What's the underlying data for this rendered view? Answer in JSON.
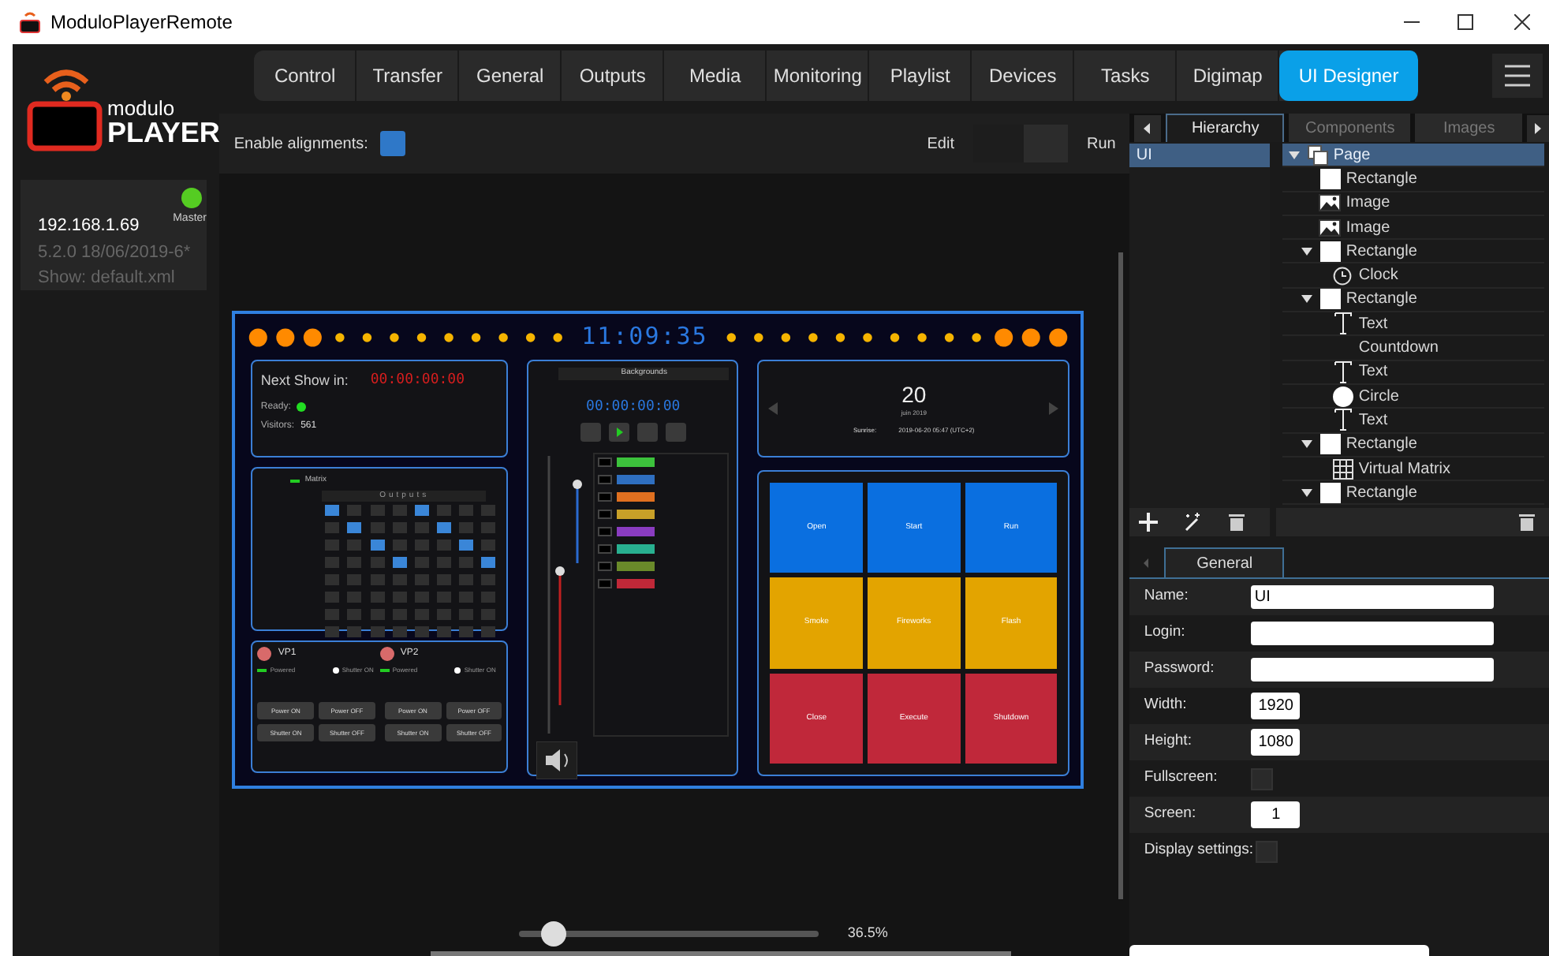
{
  "window": {
    "title": "ModuloPlayerRemote"
  },
  "logo": {
    "line_1": "modulo",
    "line_2": "PLAYER"
  },
  "server": {
    "role": "Master",
    "online": true,
    "address": "192.168.1.69",
    "version": "5.2.0 18/06/2019-6*",
    "show": "Show: default.xml"
  },
  "nav": [
    {
      "label": "Control",
      "selected": false
    },
    {
      "label": "Transfer",
      "selected": false
    },
    {
      "label": "General",
      "selected": false
    },
    {
      "label": "Outputs",
      "selected": false
    },
    {
      "label": "Media",
      "selected": false
    },
    {
      "label": "Monitoring",
      "selected": false
    },
    {
      "label": "Playlist",
      "selected": false
    },
    {
      "label": "Devices",
      "selected": false
    },
    {
      "label": "Tasks",
      "selected": false
    },
    {
      "label": "Digimap",
      "selected": false
    },
    {
      "label": "UI Designer",
      "selected": true
    }
  ],
  "toolbar": {
    "alignments_label": "Enable alignments:",
    "alignments_checked": true,
    "edit_label": "Edit",
    "run_label": "Run",
    "run_mode": false
  },
  "preview": {
    "clock": "11:09:35",
    "next_show": {
      "title": "Next Show in:",
      "countdown": "00:00:00:00",
      "ready_label": "Ready:",
      "ready": true,
      "visitors_label": "Visitors:",
      "visitors": "561"
    },
    "matrix": {
      "title": "Matrix",
      "header": "Outputs",
      "cells": [
        [
          true,
          false,
          false,
          false,
          true,
          false,
          false,
          false
        ],
        [
          false,
          true,
          false,
          false,
          false,
          true,
          false,
          false
        ],
        [
          false,
          false,
          true,
          false,
          false,
          false,
          true,
          false
        ],
        [
          false,
          false,
          false,
          true,
          false,
          false,
          false,
          true
        ],
        [
          false,
          false,
          false,
          false,
          false,
          false,
          false,
          false
        ],
        [
          false,
          false,
          false,
          false,
          false,
          false,
          false,
          false
        ],
        [
          false,
          false,
          false,
          false,
          false,
          false,
          false,
          false
        ],
        [
          false,
          false,
          false,
          false,
          false,
          false,
          false,
          false
        ]
      ]
    },
    "projectors": [
      {
        "name": "VP1",
        "status": "Powered",
        "shutter": "Shutter ON",
        "buttons": [
          "Power ON",
          "Power OFF",
          "Shutter ON",
          "Shutter OFF"
        ]
      },
      {
        "name": "VP2",
        "status": "Powered",
        "shutter": "Shutter ON",
        "buttons": [
          "Power ON",
          "Power OFF",
          "Shutter ON",
          "Shutter OFF"
        ]
      }
    ],
    "mixer": {
      "title": "Backgrounds",
      "timecode": "00:00:00:00",
      "layers": [
        {
          "color": "#3cc23c"
        },
        {
          "color": "#2f6fc0"
        },
        {
          "color": "#e07020"
        },
        {
          "color": "#c8a028"
        },
        {
          "color": "#8a3cc0"
        },
        {
          "color": "#28b090"
        },
        {
          "color": "#6a8a2a"
        },
        {
          "color": "#c02838"
        }
      ]
    },
    "date": {
      "day": "20",
      "month": "juin 2019",
      "sunrise_label": "Sunrise:",
      "sunrise": "2019-06-20 05:47 (UTC+2)"
    },
    "pads": [
      {
        "label": "Open",
        "color": "#0a6fe0"
      },
      {
        "label": "Start",
        "color": "#0a6fe0"
      },
      {
        "label": "Run",
        "color": "#0a6fe0"
      },
      {
        "label": "Smoke",
        "color": "#e3a400"
      },
      {
        "label": "Fireworks",
        "color": "#e3a400"
      },
      {
        "label": "Flash",
        "color": "#e3a400"
      },
      {
        "label": "Close",
        "color": "#c0283a"
      },
      {
        "label": "Execute",
        "color": "#c0283a"
      },
      {
        "label": "Shutdown",
        "color": "#c0283a"
      }
    ]
  },
  "zoom": {
    "level": 0.08,
    "reading": "36.5%"
  },
  "panel_tabs": [
    {
      "label": "Hierarchy",
      "selected": true
    },
    {
      "label": "Components",
      "selected": false
    },
    {
      "label": "Images",
      "selected": false
    }
  ],
  "pages": [
    {
      "label": "UI",
      "selected": true
    }
  ],
  "tree": [
    {
      "label": "Page",
      "kind": "page",
      "selected": true,
      "expanded": true,
      "children": [
        {
          "label": "Rectangle",
          "kind": "rectangle",
          "selected": false
        },
        {
          "label": "Image",
          "kind": "image",
          "selected": false
        },
        {
          "label": "Image",
          "kind": "image",
          "selected": false
        },
        {
          "label": "Rectangle",
          "kind": "rectangle",
          "selected": false,
          "expanded": true,
          "children": [
            {
              "label": "Clock",
              "kind": "clock",
              "selected": false
            }
          ]
        },
        {
          "label": "Rectangle",
          "kind": "rectangle",
          "selected": false,
          "expanded": true,
          "children": [
            {
              "label": "Text",
              "kind": "text",
              "selected": false
            },
            {
              "label": "Countdown",
              "kind": "none",
              "selected": false
            },
            {
              "label": "Text",
              "kind": "text",
              "selected": false
            },
            {
              "label": "Circle",
              "kind": "circle",
              "selected": false
            },
            {
              "label": "Text",
              "kind": "text",
              "selected": false
            }
          ]
        },
        {
          "label": "Rectangle",
          "kind": "rectangle",
          "selected": false,
          "expanded": true,
          "children": [
            {
              "label": "Virtual Matrix",
              "kind": "matrix",
              "selected": false
            }
          ]
        },
        {
          "label": "Rectangle",
          "kind": "rectangle",
          "selected": false,
          "expanded": true
        }
      ]
    }
  ],
  "properties": {
    "tab": "General",
    "fields": [
      {
        "label": "Name:",
        "kind": "text",
        "value": "UI"
      },
      {
        "label": "Login:",
        "kind": "text"
      },
      {
        "label": "Password:",
        "kind": "text"
      },
      {
        "label": "Width:",
        "kind": "number",
        "value": "1920"
      },
      {
        "label": "Height:",
        "kind": "number",
        "value": "1080"
      },
      {
        "label": "Fullscreen:",
        "kind": "checkbox",
        "checked": false
      },
      {
        "label": "Screen:",
        "kind": "number",
        "value": "1"
      },
      {
        "label": "Display settings:",
        "kind": "checkbox",
        "checked": false
      }
    ]
  }
}
